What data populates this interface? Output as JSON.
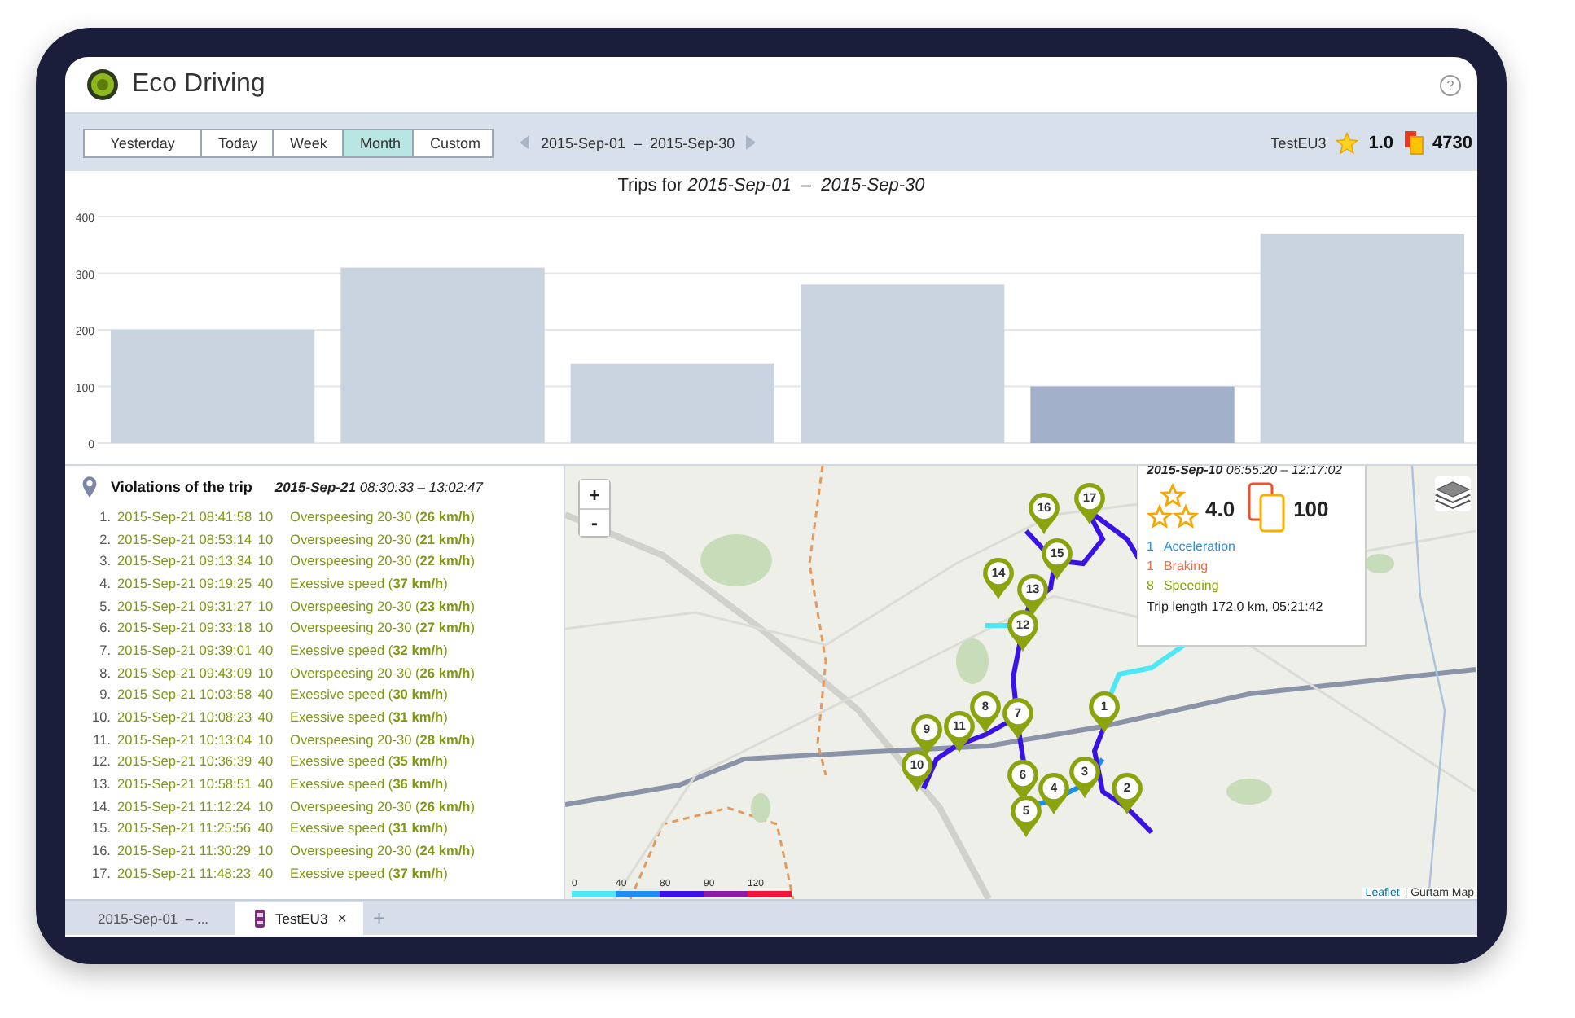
{
  "window": {
    "title": "Eco Driving",
    "help": "?"
  },
  "period_tabs": [
    {
      "label": "Yesterday",
      "selected": false
    },
    {
      "label": "Today",
      "selected": false
    },
    {
      "label": "Week",
      "selected": false
    },
    {
      "label": "Month",
      "selected": true
    },
    {
      "label": "Custom",
      "selected": false
    }
  ],
  "date_range": "2015-Sep-01  –  2015-Sep-30",
  "unit": {
    "name": "TestEU3",
    "rating": "1.0",
    "penalty": "4730"
  },
  "trips_chart": {
    "title": "Trips for *2015-Sep-01  –  2015-Sep-30*",
    "chart_data": {
      "type": "bar",
      "grid": true,
      "ylim": [
        0,
        400
      ],
      "yticks": [
        0,
        100,
        200,
        300,
        400
      ],
      "series": [
        {
          "color": "#cad3e0",
          "values": [
            200,
            310,
            140,
            280,
            null,
            370
          ]
        },
        {
          "color": "#a3b0ca",
          "values": [
            null,
            null,
            null,
            null,
            100,
            null
          ]
        }
      ]
    }
  },
  "violations": {
    "title": "Violations of the trip",
    "trip_period": "**2015-Sep-21** 08:30:33 – 13:02:47",
    "items": [
      {
        "number": "1.",
        "time": "2015-Sep-21 08:41:58",
        "points": "10",
        "description": "Overspeesing 20-30 (**26 km/h**)"
      },
      {
        "number": "2.",
        "time": "2015-Sep-21 08:53:14",
        "points": "10",
        "description": "Overspeesing 20-30 (**21 km/h**)"
      },
      {
        "number": "3.",
        "time": "2015-Sep-21 09:13:34",
        "points": "10",
        "description": "Overspeesing 20-30 (**22 km/h**)"
      },
      {
        "number": "4.",
        "time": "2015-Sep-21 09:19:25",
        "points": "40",
        "description": "Exessive speed (**37 km/h**)"
      },
      {
        "number": "5.",
        "time": "2015-Sep-21 09:31:27",
        "points": "10",
        "description": "Overspeesing 20-30 (**23 km/h**)"
      },
      {
        "number": "6.",
        "time": "2015-Sep-21 09:33:18",
        "points": "10",
        "description": "Overspeesing 20-30 (**27 km/h**)"
      },
      {
        "number": "7.",
        "time": "2015-Sep-21 09:39:01",
        "points": "40",
        "description": "Exessive speed (**32 km/h**)"
      },
      {
        "number": "8.",
        "time": "2015-Sep-21 09:43:09",
        "points": "10",
        "description": "Overspeesing 20-30 (**26 km/h**)"
      },
      {
        "number": "9.",
        "time": "2015-Sep-21 10:03:58",
        "points": "40",
        "description": "Exessive speed (**30 km/h**)"
      },
      {
        "number": "10.",
        "time": "2015-Sep-21 10:08:23",
        "points": "40",
        "description": "Exessive speed (**31 km/h**)"
      },
      {
        "number": "11.",
        "time": "2015-Sep-21 10:13:04",
        "points": "10",
        "description": "Overspeesing 20-30 (**28 km/h**)"
      },
      {
        "number": "12.",
        "time": "2015-Sep-21 10:36:39",
        "points": "40",
        "description": "Exessive speed (**35 km/h**)"
      },
      {
        "number": "13.",
        "time": "2015-Sep-21 10:58:51",
        "points": "40",
        "description": "Exessive speed (**36 km/h**)"
      },
      {
        "number": "14.",
        "time": "2015-Sep-21 11:12:24",
        "points": "10",
        "description": "Overspeesing 20-30 (**26 km/h**)"
      },
      {
        "number": "15.",
        "time": "2015-Sep-21 11:25:56",
        "points": "40",
        "description": "Exessive speed (**31 km/h**)"
      },
      {
        "number": "16.",
        "time": "2015-Sep-21 11:30:29",
        "points": "10",
        "description": "Overspeesing 20-30 (**24 km/h**)"
      },
      {
        "number": "17.",
        "time": "2015-Sep-21 11:48:23",
        "points": "40",
        "description": "Exessive speed (**37 km/h**)"
      }
    ]
  },
  "map": {
    "kind": "picture",
    "zoom_in": "+",
    "zoom_out": "-",
    "markers": [
      {
        "label": "17"
      },
      {
        "label": "16"
      },
      {
        "label": "15"
      },
      {
        "label": "14"
      },
      {
        "label": "13"
      },
      {
        "label": "12"
      },
      {
        "label": "1"
      },
      {
        "label": "8"
      },
      {
        "label": "7"
      },
      {
        "label": "11"
      },
      {
        "label": "9"
      },
      {
        "label": "10"
      },
      {
        "label": "3"
      },
      {
        "label": "6"
      },
      {
        "label": "4"
      },
      {
        "label": "2"
      },
      {
        "label": "5"
      }
    ],
    "speed_legend": [
      {
        "label": "0",
        "color": "#4ee8f4"
      },
      {
        "label": "40",
        "color": "#1e8ff0"
      },
      {
        "label": "80",
        "color": "#3a12e6"
      },
      {
        "label": "90",
        "color": "#8e1aa8"
      },
      {
        "label": "120",
        "color": "#f0143c"
      }
    ],
    "attribution": {
      "link": "Leaflet",
      "text": "| Gurtam Map"
    },
    "popup": {
      "period": "**2015-Sep-10** 06:55:20 – 12:17:02",
      "rating": "4.0",
      "penalty": "100",
      "events": [
        {
          "count": "1",
          "label": "Acceleration",
          "color": "#2a8fdc"
        },
        {
          "count": "1",
          "label": "Braking",
          "color": "#f06a3c"
        },
        {
          "count": "8",
          "label": "Speeding",
          "color": "#86a500"
        }
      ],
      "trip_length": "Trip length 172.0 km, 05:21:42"
    }
  },
  "bottom_tabs": [
    {
      "label": "2015-Sep-01  – ...",
      "selected": false,
      "closable": false,
      "kind": "period"
    },
    {
      "label": "TestEU3",
      "selected": true,
      "closable": true,
      "kind": "unit",
      "close": "×"
    }
  ],
  "add_tab": "+"
}
